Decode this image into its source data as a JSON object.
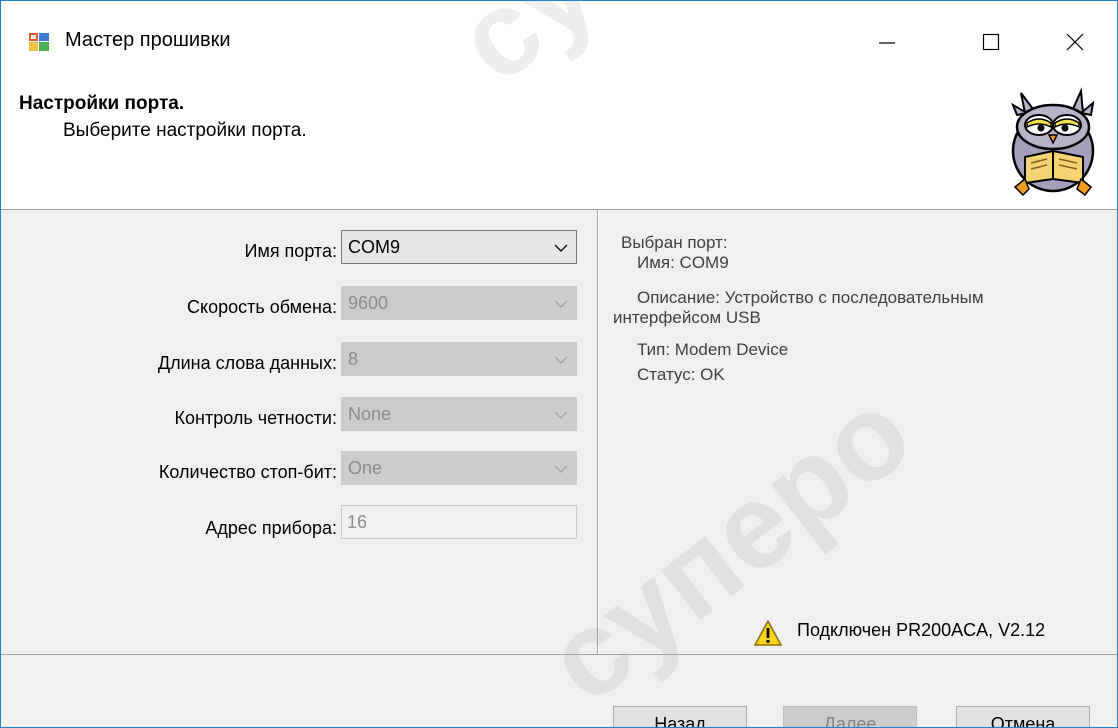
{
  "window": {
    "title": "Мастер прошивки"
  },
  "header": {
    "title": "Настройки порта.",
    "subtitle": "Выберите настройки порта."
  },
  "settings": {
    "port_name": {
      "label": "Имя порта:",
      "value": "COM9",
      "enabled": true
    },
    "baud_rate": {
      "label": "Скорость обмена:",
      "value": "9600",
      "enabled": false
    },
    "data_bits": {
      "label": "Длина слова данных:",
      "value": "8",
      "enabled": false
    },
    "parity": {
      "label": "Контроль четности:",
      "value": "None",
      "enabled": false
    },
    "stop_bits": {
      "label": "Количество стоп-бит:",
      "value": "One",
      "enabled": false
    },
    "device_address": {
      "label": "Адрес прибора:",
      "value": "16",
      "enabled": false
    }
  },
  "port_info": {
    "heading": "Выбран порт:",
    "name": "Имя: COM9",
    "description_1": "Описание: Устройство с последовательным",
    "description_2": "интерфейсом USB",
    "type": "Тип: Modem Device",
    "status": "Статус: OK"
  },
  "status": {
    "text": "Подключен PR200ACA, V2.12",
    "icon": "warning-icon"
  },
  "buttons": {
    "back": "Назад",
    "next": "Далее",
    "cancel": "Отмена"
  },
  "watermark": {
    "text_1": "cyпepo",
    "text_2": "cyпepo"
  },
  "colors": {
    "window_border": "#1883d7",
    "warning": "#ffd21f",
    "disabled_text": "#8c8c8c"
  }
}
